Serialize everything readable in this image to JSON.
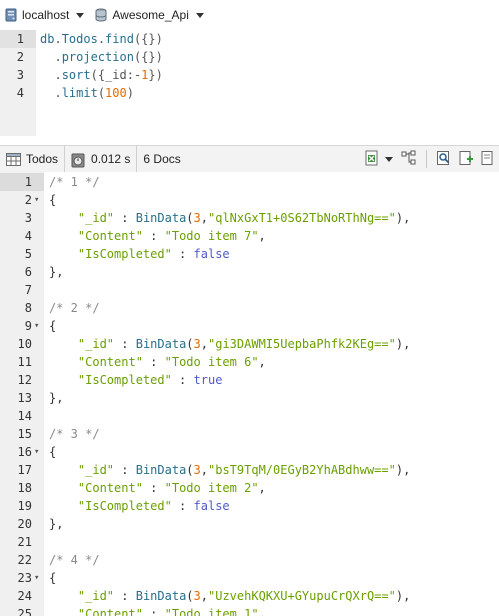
{
  "connection": {
    "host_label": "localhost",
    "database_label": "Awesome_Api"
  },
  "query_editor": {
    "lines": [
      {
        "num": "1",
        "parts": [
          [
            "db",
            "id"
          ],
          [
            ".",
            "p"
          ],
          [
            "Todos",
            "id"
          ],
          [
            ".",
            "p"
          ],
          [
            "find",
            "fn"
          ],
          [
            "({})",
            "p"
          ]
        ]
      },
      {
        "num": "2",
        "parts": [
          [
            "  .",
            "p"
          ],
          [
            "projection",
            "fn"
          ],
          [
            "({})",
            "p"
          ]
        ]
      },
      {
        "num": "3",
        "parts": [
          [
            "  .",
            "p"
          ],
          [
            "sort",
            "fn"
          ],
          [
            "({_id:-",
            "p"
          ],
          [
            "1",
            "num"
          ],
          [
            "})",
            "p"
          ]
        ]
      },
      {
        "num": "4",
        "parts": [
          [
            "  .",
            "p"
          ],
          [
            "limit",
            "fn"
          ],
          [
            "(",
            "p"
          ],
          [
            "100",
            "num"
          ],
          [
            ")",
            "p"
          ]
        ]
      }
    ]
  },
  "results_toolbar": {
    "collection_label": "Todos",
    "time_label": "0.012 s",
    "docs_label": "6 Docs"
  },
  "results": {
    "documents": [
      {
        "index": "1",
        "id": "qlNxGxT1+0S62TbNoRThNg==",
        "content": "Todo item 7",
        "completed": "false"
      },
      {
        "index": "2",
        "id": "gi3DAWMI5UepbaPhfk2KEg==",
        "content": "Todo item 6",
        "completed": "true"
      },
      {
        "index": "3",
        "id": "bsT9TqM/0EGyB2YhABdhww==",
        "content": "Todo item 2",
        "completed": "false"
      },
      {
        "index": "4",
        "id": "UzvehKQKXU+GYupuCrQXrQ==",
        "content": "Todo item 1",
        "completed": null
      }
    ]
  },
  "colors": {
    "key": "#6aa000",
    "function": "#26708c",
    "number": "#e66a00",
    "boolean": "#4f5bc9",
    "comment": "#8a8a8a"
  }
}
